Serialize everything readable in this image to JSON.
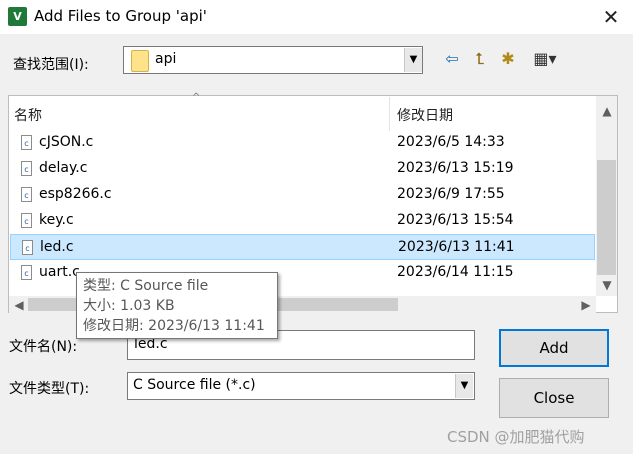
{
  "window": {
    "title": "Add Files to Group 'api'",
    "close_glyph": "✕",
    "icon_glyph": "V"
  },
  "lookin": {
    "label": "查找范围(I):",
    "value": "api"
  },
  "columns": {
    "name": "名称",
    "modified": "修改日期",
    "sort_glyph": "^"
  },
  "files": [
    {
      "name": "cJSON.c",
      "date": "2023/6/5 14:33"
    },
    {
      "name": "delay.c",
      "date": "2023/6/13 15:19"
    },
    {
      "name": "esp8266.c",
      "date": "2023/6/9 17:55"
    },
    {
      "name": "key.c",
      "date": "2023/6/13 15:54"
    },
    {
      "name": "led.c",
      "date": "2023/6/13 11:41",
      "selected": true
    },
    {
      "name": "uart.c",
      "date": "2023/6/14 11:15"
    }
  ],
  "file_icon_glyph": "c",
  "tooltip": {
    "type": "类型: C Source file",
    "size": "大小: 1.03 KB",
    "modified": "修改日期: 2023/6/13 11:41"
  },
  "filename": {
    "label": "文件名(N):",
    "value": "led.c"
  },
  "filetype": {
    "label": "文件类型(T):",
    "value": "C Source file (*.c)"
  },
  "buttons": {
    "add": "Add",
    "close": "Close"
  },
  "toolbar_icons": [
    "back-arrow-icon",
    "up-folder-icon",
    "new-folder-icon",
    "view-menu-icon"
  ],
  "watermark": "CSDN @加肥猫代购"
}
